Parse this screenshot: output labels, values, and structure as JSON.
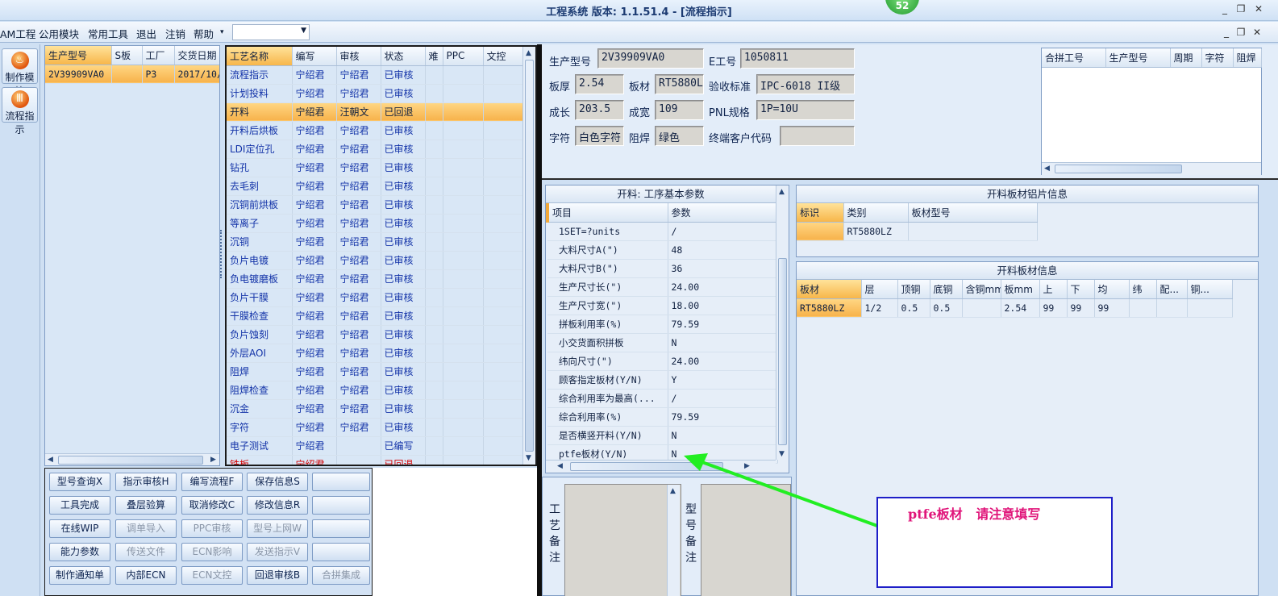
{
  "window": {
    "title": "工程系统  版本: 1.1.51.4 - [流程指示]",
    "badge": "52",
    "controls": [
      "_",
      "❐",
      "✕"
    ],
    "mdi_controls": [
      "_",
      "❐",
      "✕"
    ]
  },
  "menu": {
    "items": [
      "AM工程",
      "公用模块",
      "常用工具",
      "退出",
      "注销",
      "帮助"
    ],
    "help_arrow": "▾",
    "combo_value": ""
  },
  "rail": {
    "items": [
      {
        "label": "制作模块"
      },
      {
        "label": "流程指示"
      }
    ]
  },
  "jobs": {
    "columns": [
      "生产型号",
      "S板",
      "工厂",
      "交货日期"
    ],
    "rows": [
      {
        "model": "2V39909VA0",
        "s": "",
        "factory": "P3",
        "date": "2017/10/"
      }
    ]
  },
  "process": {
    "columns": [
      "工艺名称",
      "编写",
      "审核",
      "状态",
      "难",
      "PPC",
      "文控"
    ],
    "rows": [
      {
        "name": "流程指示",
        "writer": "宁绍君",
        "reviewer": "宁绍君",
        "status": "已审核"
      },
      {
        "name": "计划投料",
        "writer": "宁绍君",
        "reviewer": "宁绍君",
        "status": "已审核"
      },
      {
        "name": "开料",
        "writer": "宁绍君",
        "reviewer": "汪朝文",
        "status": "已回退"
      },
      {
        "name": "开料后烘板",
        "writer": "宁绍君",
        "reviewer": "宁绍君",
        "status": "已审核"
      },
      {
        "name": "LDI定位孔",
        "writer": "宁绍君",
        "reviewer": "宁绍君",
        "status": "已审核"
      },
      {
        "name": "钻孔",
        "writer": "宁绍君",
        "reviewer": "宁绍君",
        "status": "已审核"
      },
      {
        "name": "去毛刺",
        "writer": "宁绍君",
        "reviewer": "宁绍君",
        "status": "已审核"
      },
      {
        "name": "沉铜前烘板",
        "writer": "宁绍君",
        "reviewer": "宁绍君",
        "status": "已审核"
      },
      {
        "name": "等离子",
        "writer": "宁绍君",
        "reviewer": "宁绍君",
        "status": "已审核"
      },
      {
        "name": "沉铜",
        "writer": "宁绍君",
        "reviewer": "宁绍君",
        "status": "已审核"
      },
      {
        "name": "负片电镀",
        "writer": "宁绍君",
        "reviewer": "宁绍君",
        "status": "已审核"
      },
      {
        "name": "负电镀磨板",
        "writer": "宁绍君",
        "reviewer": "宁绍君",
        "status": "已审核"
      },
      {
        "name": "负片干膜",
        "writer": "宁绍君",
        "reviewer": "宁绍君",
        "status": "已审核"
      },
      {
        "name": "干膜检查",
        "writer": "宁绍君",
        "reviewer": "宁绍君",
        "status": "已审核"
      },
      {
        "name": "负片蚀刻",
        "writer": "宁绍君",
        "reviewer": "宁绍君",
        "status": "已审核"
      },
      {
        "name": "外层AOI",
        "writer": "宁绍君",
        "reviewer": "宁绍君",
        "status": "已审核"
      },
      {
        "name": "阻焊",
        "writer": "宁绍君",
        "reviewer": "宁绍君",
        "status": "已审核"
      },
      {
        "name": "阻焊检查",
        "writer": "宁绍君",
        "reviewer": "宁绍君",
        "status": "已审核"
      },
      {
        "name": "沉金",
        "writer": "宁绍君",
        "reviewer": "宁绍君",
        "status": "已审核"
      },
      {
        "name": "字符",
        "writer": "宁绍君",
        "reviewer": "宁绍君",
        "status": "已审核"
      },
      {
        "name": "电子测试",
        "writer": "宁绍君",
        "reviewer": "",
        "status": "已编写"
      },
      {
        "name": "铣板",
        "writer": "宁绍君",
        "reviewer": "",
        "status": "已回退"
      }
    ]
  },
  "buttons": [
    [
      "型号查询X",
      "指示审核H",
      "编写流程F",
      "保存信息S",
      ""
    ],
    [
      "工具完成",
      "叠层验算",
      "取消修改C",
      "修改信息R",
      ""
    ],
    [
      "在线WIP",
      "调单导入",
      "PPC审核",
      "型号上网W",
      ""
    ],
    [
      "能力参数",
      "传送文件",
      "ECN影响",
      "发送指示V",
      ""
    ],
    [
      "制作通知单",
      "内部ECN",
      "ECN文控",
      "回退审核B",
      "合拼集成"
    ]
  ],
  "info": {
    "model_label": "生产型号",
    "model": "2V39909VA0",
    "eno_label": "E工号",
    "eno": "1050811",
    "thick_label": "板厚",
    "thick": "2.54",
    "material_label": "板材",
    "material": "RT5880L",
    "accept_label": "验收标准",
    "accept": "IPC-6018 II级",
    "len_label": "成长",
    "len": "203.5",
    "width_label": "成宽",
    "width": "109",
    "pnl_label": "PNL规格",
    "pnl": "1P=10U",
    "char_label": "字符",
    "char": "白色字符",
    "mask_label": "阻焊",
    "mask": "绿色",
    "cust_label": "终端客户代码",
    "cust": ""
  },
  "merge": {
    "columns": [
      "合拼工号",
      "生产型号",
      "周期",
      "字符",
      "阻焊"
    ]
  },
  "params": {
    "title": "开料: 工序基本参数",
    "columns": [
      "项目",
      "参数"
    ],
    "rows": [
      {
        "item": "1SET=?units",
        "value": "/"
      },
      {
        "item": "大料尺寸A(\")",
        "value": "48"
      },
      {
        "item": "大料尺寸B(\")",
        "value": "36"
      },
      {
        "item": "生产尺寸长(\")",
        "value": "24.00"
      },
      {
        "item": "生产尺寸宽(\")",
        "value": "18.00"
      },
      {
        "item": "拼板利用率(%)",
        "value": "79.59"
      },
      {
        "item": "小交货面积拼板",
        "value": "N"
      },
      {
        "item": "纬向尺寸(\")",
        "value": "24.00"
      },
      {
        "item": "顾客指定板材(Y/N)",
        "value": "Y"
      },
      {
        "item": "综合利用率为最高(...",
        "value": "/"
      },
      {
        "item": "综合利用率(%)",
        "value": "79.59"
      },
      {
        "item": "是否横竖开料(Y/N)",
        "value": "N"
      },
      {
        "item": "ptfe板材(Y/N)",
        "value": "N"
      }
    ]
  },
  "foil": {
    "title": "开料板材铝片信息",
    "columns": [
      "标识",
      "类别",
      "板材型号"
    ],
    "rows": [
      {
        "mark": "",
        "kind": "RT5880LZ",
        "model": ""
      }
    ]
  },
  "board": {
    "title": "开料板材信息",
    "columns": [
      "板材",
      "层",
      "顶铜",
      "底铜",
      "含铜mm",
      "板mm",
      "上",
      "下",
      "均",
      "纬",
      "配...",
      "铜..."
    ],
    "rows": [
      [
        "RT5880LZ",
        "1/2",
        "0.5",
        "0.5",
        "",
        "2.54",
        "99",
        "99",
        "99",
        "",
        "",
        ""
      ]
    ]
  },
  "notes": {
    "process_label": "工艺备注",
    "model_label": "型号备注"
  },
  "annotation": {
    "text": "ptfe板材   请注意填写",
    "arrow_color": "#22ee22",
    "text_color": "#e0157a",
    "box_color": "#1e1ec8"
  }
}
